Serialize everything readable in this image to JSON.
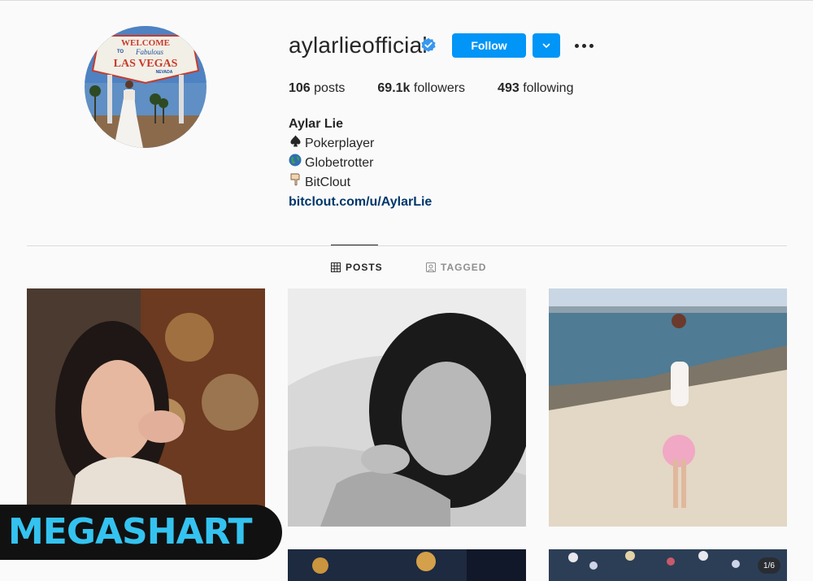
{
  "profile": {
    "username": "aylarlieofficial",
    "verified": true,
    "follow_label": "Follow",
    "stats": {
      "posts_count": "106",
      "posts_label": "posts",
      "followers_count": "69.1k",
      "followers_label": "followers",
      "following_count": "493",
      "following_label": "following"
    },
    "bio": {
      "name": "Aylar Lie",
      "lines": [
        {
          "icon": "spade",
          "text": "Pokerplayer"
        },
        {
          "icon": "globe",
          "text": "Globetrotter"
        },
        {
          "icon": "pointing-hand",
          "text": "BitClout"
        }
      ],
      "link": "bitclout.com/u/AylarLie"
    },
    "avatar_sign": {
      "welcome": "WELCOME",
      "to": "TO",
      "fabulous": "Fabulous",
      "city": "LAS VEGAS",
      "state": "NEVADA"
    }
  },
  "tabs": [
    {
      "label": "POSTS",
      "icon": "grid-icon",
      "active": true
    },
    {
      "label": "TAGGED",
      "icon": "tag-icon",
      "active": false
    }
  ],
  "grid": {
    "badge_text": "1/6"
  },
  "watermark": {
    "text": "MEGASHART"
  },
  "colors": {
    "accent": "#0095f6",
    "link": "#00376b",
    "text": "#262626",
    "muted": "#8e8e8e",
    "background": "#fafafa"
  }
}
